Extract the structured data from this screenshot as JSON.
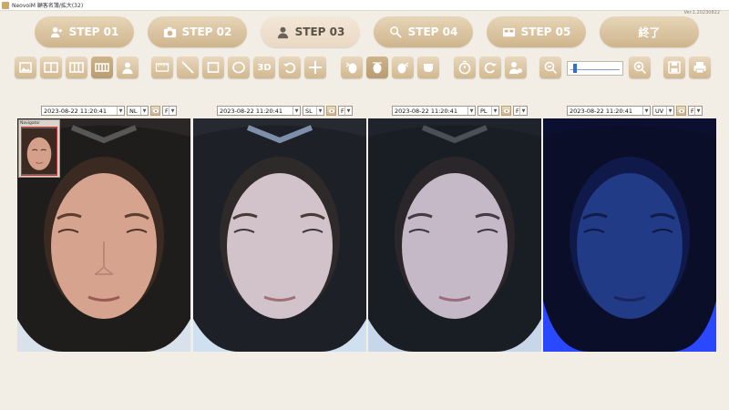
{
  "window": {
    "title": "NeovoiM 顧客名簿/拡大(32)",
    "version": "Ver.1.20230822"
  },
  "steps": [
    {
      "label": "STEP 01",
      "icon": "user-add-icon",
      "active": false
    },
    {
      "label": "STEP 02",
      "icon": "camera-icon",
      "active": false
    },
    {
      "label": "STEP 03",
      "icon": "person-icon",
      "active": true
    },
    {
      "label": "STEP 04",
      "icon": "analysis-icon",
      "active": false
    },
    {
      "label": "STEP 05",
      "icon": "report-icon",
      "active": false
    },
    {
      "label": "終了",
      "icon": "",
      "active": false
    }
  ],
  "toolbar": {
    "zoom_slider_value": 0.05,
    "icons": [
      "single-view-icon",
      "two-split-icon",
      "three-split-icon",
      "four-split-icon",
      "face-icon",
      "ruler-icon",
      "line-tool-icon",
      "rectangle-tool-icon",
      "ellipse-tool-icon",
      "3d-icon",
      "undo-icon",
      "crosshair-icon",
      "face-left-icon",
      "face-front-icon",
      "face-right-icon",
      "chin-icon",
      "timer-icon",
      "redo-icon",
      "user-settings-icon",
      "zoom-out-icon",
      "zoom-in-icon",
      "save-icon",
      "print-icon"
    ],
    "three_d_label": "3D"
  },
  "navigator": {
    "title": "Navigator"
  },
  "panels": [
    {
      "timestamp": "2023-08-22 11:20:41",
      "mode": "NL",
      "facing": "F",
      "tone": "#d6a38e"
    },
    {
      "timestamp": "2023-08-22 11:20:41",
      "mode": "SL",
      "facing": "F",
      "tone": "#d2c3ca"
    },
    {
      "timestamp": "2023-08-22 11:20:41",
      "mode": "PL",
      "facing": "F",
      "tone": "#c5b8c7"
    },
    {
      "timestamp": "2023-08-22 11:20:41",
      "mode": "UV",
      "facing": "F",
      "tone": "#213b86"
    }
  ],
  "colors": {
    "accent": "#cfb58d",
    "active_step": "#eadac4",
    "background": "#f2ede5"
  }
}
